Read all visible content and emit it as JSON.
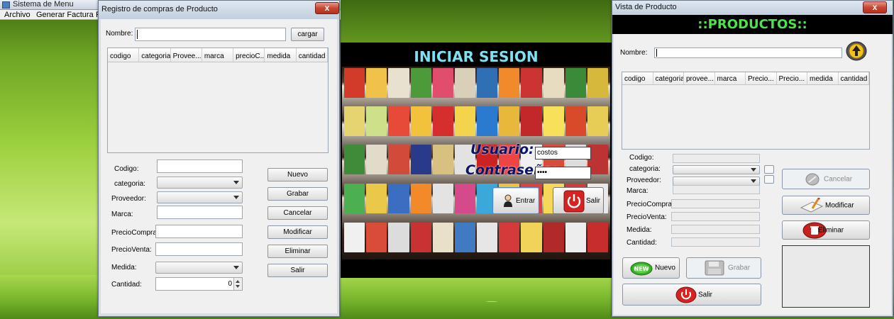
{
  "main_window": {
    "title": "Sistema de Menu",
    "menu": [
      "Archivo",
      "Generar Factura",
      "R"
    ]
  },
  "registro": {
    "title": "Registro de compras de Producto",
    "close": "x",
    "nombre_label": "Nombre:",
    "cargar_label": "cargar",
    "columns": [
      "codigo",
      "categoria",
      "Provee...",
      "marca",
      "precioC...",
      "medida",
      "cantidad"
    ],
    "fields": {
      "codigo": "Codigo:",
      "categoria": "categoria:",
      "proveedor": "Proveedor:",
      "marca": "Marca:",
      "precio_compra": "PrecioCompra:",
      "precio_venta": "PrecioVenta:",
      "medida": "Medida:",
      "cantidad": "Cantidad:"
    },
    "cantidad_value": "0",
    "buttons": {
      "nuevo": "Nuevo",
      "grabar": "Grabar",
      "cancelar": "Cancelar",
      "modificar": "Modificar",
      "eliminar": "Eliminar",
      "salir": "Salir"
    }
  },
  "login": {
    "title": "INICIAR SESION",
    "usuario_label": "Usuario:",
    "usuario_value": "costos",
    "password_label": "Contraseña:",
    "password_value": "••••",
    "entrar_label": "Entrar",
    "salir_label": "Salir"
  },
  "productos": {
    "title": "Vista de Producto",
    "close": "x",
    "heading": "::PRODUCTOS::",
    "nombre_label": "Nombre:",
    "columns": [
      "codigo",
      "categoria",
      "provee...",
      "marca",
      "Precio...",
      "Precio...",
      "medida",
      "cantidad"
    ],
    "fields": {
      "codigo": "Codigo:",
      "categoria": "categoria:",
      "proveedor": "Proveedor:",
      "marca": "Marca:",
      "precio_compra": "PrecioCompra:",
      "precio_venta": "PrecioVenta:",
      "medida": "Medida:",
      "cantidad": "Cantidad:"
    },
    "buttons": {
      "cancelar": "Cancelar",
      "modificar": "Modificar",
      "eliminar": "Eliminar",
      "nuevo": "Nuevo",
      "nuevo_badge": "NEW",
      "grabar": "Grabar",
      "salir": "Salir"
    }
  },
  "colors": {
    "login_title": "#7ee0f0",
    "productos_heading": "#4ee34a",
    "close_button": "#c84631"
  }
}
